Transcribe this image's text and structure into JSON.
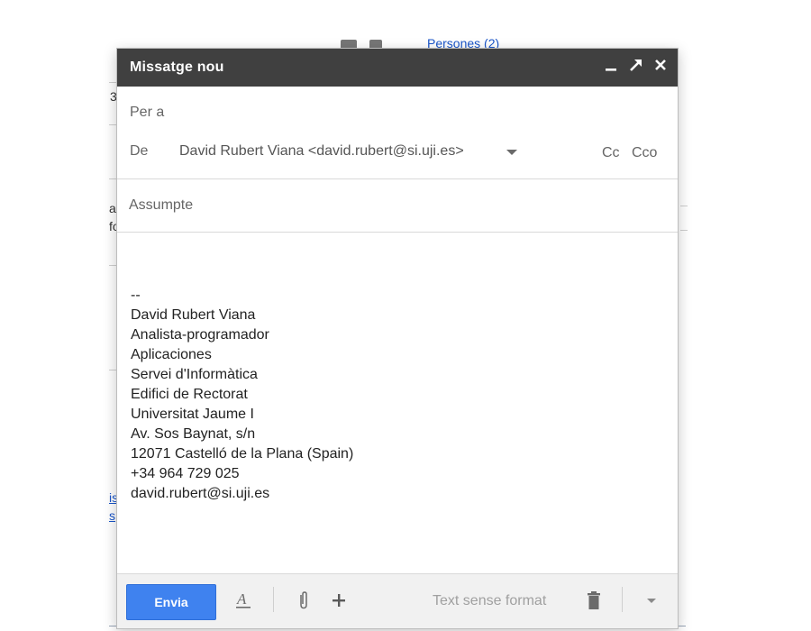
{
  "background": {
    "link_text": "Persones (2)",
    "fragments": [
      "3",
      "al",
      "fo",
      "is",
      "s"
    ]
  },
  "compose": {
    "title": "Missatge nou",
    "to_label": "Per a",
    "from_label": "De",
    "from_value": "David Rubert Viana <david.rubert@si.uji.es>",
    "cc_label": "Cc",
    "bcc_label": "Cco",
    "subject_placeholder": "Assumpte",
    "signature": [
      "--",
      "David Rubert Viana",
      "Analista-programador",
      "Aplicaciones",
      "Servei d'Informàtica",
      "Edifici de Rectorat",
      "Universitat Jaume I",
      "Av. Sos Baynat, s/n",
      "12071 Castelló de la Plana (Spain)",
      "+34 964 729 025",
      "david.rubert@si.uji.es"
    ],
    "toolbar": {
      "send_label": "Envia",
      "format_link": "Text sense format"
    },
    "icons": {
      "minimize": "minimize-icon",
      "popout": "popout-icon",
      "close": "close-icon",
      "formatting": "text-format-icon",
      "attach": "paperclip-icon",
      "more": "plus-icon",
      "discard": "trash-icon",
      "more_options": "chevron-down-icon"
    }
  }
}
